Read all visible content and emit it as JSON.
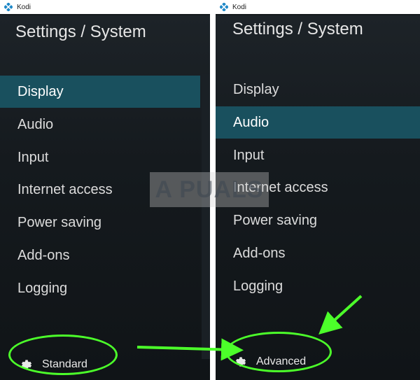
{
  "left": {
    "window_title": "Kodi",
    "header": "Settings / System",
    "menu": [
      "Display",
      "Audio",
      "Input",
      "Internet access",
      "Power saving",
      "Add-ons",
      "Logging"
    ],
    "active_index": 0,
    "level_label": "Standard"
  },
  "right": {
    "window_title": "Kodi",
    "header": "Settings / System",
    "menu": [
      "Display",
      "Audio",
      "Input",
      "Internet access",
      "Power saving",
      "Add-ons",
      "Logging"
    ],
    "active_index": 1,
    "level_label": "Advanced"
  },
  "watermark": "A PUALS",
  "colors": {
    "highlight": "#4cff2a",
    "active_bg": "#19505e",
    "panel_bg": "#14191d"
  },
  "icons": [
    "kodi-logo-icon",
    "gear-icon",
    "arrow-icon"
  ]
}
